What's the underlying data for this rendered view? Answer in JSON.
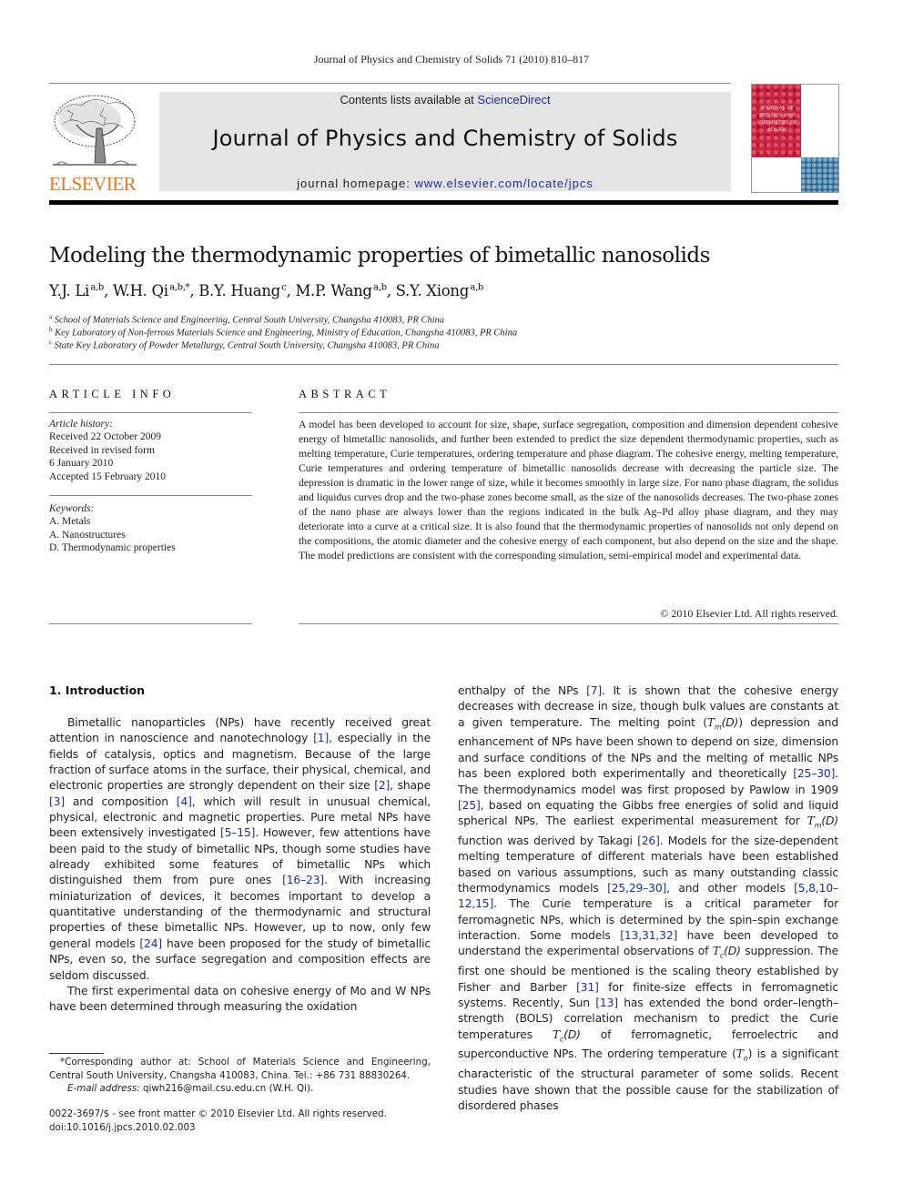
{
  "running_head": "Journal of Physics and Chemistry of Solids 71 (2010) 810–817",
  "header": {
    "contents_prefix": "Contents lists available at ",
    "contents_link": "ScienceDirect",
    "journal_title": "Journal of Physics and Chemistry of Solids",
    "homepage_prefix": "journal homepage: ",
    "homepage_link": "www.elsevier.com/locate/jpcs",
    "publisher_logo_text": "ELSEVIER",
    "cover_text": "JOURNAL OF PHYSICS AND CHEMISTRY OF SOLIDS",
    "colors": {
      "publisher_orange": "#e87722",
      "link_blue": "#1a2fa0",
      "header_gray": "#e4e4e4",
      "cover_red": "#c8233f",
      "cover_blue": "#2d6690"
    }
  },
  "article": {
    "title": "Modeling the thermodynamic properties of bimetallic nanosolids",
    "authors": [
      {
        "name": "Y.J. Li",
        "sup": "a,b"
      },
      {
        "name": "W.H. Qi",
        "sup": "a,b,*"
      },
      {
        "name": "B.Y. Huang",
        "sup": "c"
      },
      {
        "name": "M.P. Wang",
        "sup": "a,b"
      },
      {
        "name": "S.Y. Xiong",
        "sup": "a,b"
      }
    ],
    "affiliations": [
      {
        "key": "a",
        "text": "School of Materials Science and Engineering, Central South University, Changsha 410083, PR China"
      },
      {
        "key": "b",
        "text": "Key Laboratory of Non-ferrous Materials Science and Engineering, Ministry of Education, Changsha 410083, PR China"
      },
      {
        "key": "c",
        "text": "State Key Laboratory of Powder Metallurgy, Central South University, Changsha 410083, PR China"
      }
    ]
  },
  "article_info": {
    "heading": "ARTICLE INFO",
    "history_label": "Article history:",
    "history": [
      "Received 22 October 2009",
      "Received in revised form",
      "6 January 2010",
      "Accepted 15 February 2010"
    ],
    "keywords_label": "Keywords:",
    "keywords": [
      "A. Metals",
      "A. Nanostructures",
      "D. Thermodynamic properties"
    ]
  },
  "abstract": {
    "heading": "ABSTRACT",
    "text": "A model has been developed to account for size, shape, surface segregation, composition and dimension dependent cohesive energy of bimetallic nanosolids, and further been extended to predict the size dependent thermodynamic properties, such as melting temperature, Curie temperatures, ordering temperature and phase diagram. The cohesive energy, melting temperature, Curie temperatures and ordering temperature of bimetallic nanosolids decrease with decreasing the particle size. The depression is dramatic in the lower range of size, while it becomes smoothly in large size. For nano phase diagram, the solidus and liquidus curves drop and the two-phase zones become small, as the size of the nanosolids decreases. The two-phase zones of the nano phase are always lower than the regions indicated in the bulk Ag–Pd alloy phase diagram, and they may deteriorate into a curve at a critical size. It is also found that the thermodynamic properties of nanosolids not only depend on the compositions, the atomic diameter and the cohesive energy of each component, but also depend on the size and the shape. The model predictions are consistent with the corresponding simulation, semi-empirical model and experimental data.",
    "copyright": "© 2010 Elsevier Ltd. All rights reserved."
  },
  "introduction": {
    "heading": "1.  Introduction",
    "left_paragraphs": [
      [
        {
          "t": "Bimetallic nanoparticles (NPs) have recently received great attention in nanoscience and nanotechnology "
        },
        {
          "r": "[1]"
        },
        {
          "t": ", especially in the fields of catalysis, optics and magnetism. Because of the large fraction of surface atoms in the surface, their physical, chemical, and electronic properties are strongly dependent on their size "
        },
        {
          "r": "[2]"
        },
        {
          "t": ", shape "
        },
        {
          "r": "[3]"
        },
        {
          "t": " and composition "
        },
        {
          "r": "[4]"
        },
        {
          "t": ", which will result in unusual chemical, physical, electronic and magnetic properties. Pure metal NPs have been extensively investigated "
        },
        {
          "r": "[5–15]"
        },
        {
          "t": ". However, few attentions have been paid to the study of bimetallic NPs, though some studies have already exhibited some features of bimetallic NPs which distinguished them from pure ones "
        },
        {
          "r": "[16–23]"
        },
        {
          "t": ". With increasing miniaturization of devices, it becomes important to develop a quantitative understanding of the thermodynamic and structural properties of these bimetallic NPs. However, up to now, only few general models "
        },
        {
          "r": "[24]"
        },
        {
          "t": " have been proposed for the study of bimetallic NPs, even so, the surface segregation and composition effects are seldom discussed."
        }
      ],
      [
        {
          "t": "The first experimental data on cohesive energy of Mo and W NPs have been determined through measuring the oxidation"
        }
      ]
    ],
    "right_paragraphs": [
      [
        {
          "t": "enthalpy of the NPs "
        },
        {
          "r": "[7]"
        },
        {
          "t": ". It is shown that the cohesive energy decreases with decrease in size, though bulk values are constants at a given temperature. The melting point ("
        },
        {
          "m": "T",
          "sub": "m",
          "after": "(D)"
        },
        {
          "t": ") depression and enhancement of NPs have been shown to depend on size, dimension and surface conditions of the NPs and the melting of metallic NPs has been explored both experimentally and theoretically "
        },
        {
          "r": "[25–30]"
        },
        {
          "t": ". The thermodynamics model was first proposed by Pawlow in 1909 "
        },
        {
          "r": "[25]"
        },
        {
          "t": ", based on equating the Gibbs free energies of solid and liquid spherical NPs. The earliest experimental measurement for "
        },
        {
          "m": "T",
          "sub": "m",
          "after": "(D)"
        },
        {
          "t": " function was derived by Takagi "
        },
        {
          "r": "[26]"
        },
        {
          "t": ". Models for the size-dependent melting temperature of different materials have been established based on various assumptions, such as many outstanding classic thermodynamics models "
        },
        {
          "r": "[25,29–30]"
        },
        {
          "t": ", and other models "
        },
        {
          "r": "[5,8,10–12,15]"
        },
        {
          "t": ". The Curie temperature is a critical parameter for ferromagnetic NPs, which is determined by the spin–spin exchange interaction. Some models "
        },
        {
          "r": "[13,31,32]"
        },
        {
          "t": " have been developed to understand the experimental observations of "
        },
        {
          "m": "T",
          "sub": "c",
          "after": "(D)"
        },
        {
          "t": " suppression. The first one should be mentioned is the scaling theory established by Fisher and Barber "
        },
        {
          "r": "[31]"
        },
        {
          "t": " for finite-size effects in ferromagnetic systems. Recently, Sun "
        },
        {
          "r": "[13]"
        },
        {
          "t": " has extended the bond order–length–strength (BOLS) correlation mechanism to predict the Curie temperatures "
        },
        {
          "m": "T",
          "sub": "c",
          "after": "(D)"
        },
        {
          "t": " of ferromagnetic, ferroelectric and superconductive NPs. The ordering temperature ("
        },
        {
          "m": "T",
          "sub": "o",
          "after": ""
        },
        {
          "t": ") is a significant characteristic of the structural parameter of some solids. Recent studies have shown that the possible cause for the stabilization of disordered phases"
        }
      ]
    ]
  },
  "footnote": {
    "corresponding": "*Corresponding author at: School of Materials Science and Engineering, Central South University, Changsha 410083, China. Tel.: +86 731 88830264.",
    "email_label": "E-mail address:",
    "email": " qiwh216@mail.csu.edu.cn (W.H. Qi).",
    "issn": "0022-3697/$ - see front matter © 2010 Elsevier Ltd. All rights reserved.",
    "doi": "doi:10.1016/j.jpcs.2010.02.003"
  }
}
